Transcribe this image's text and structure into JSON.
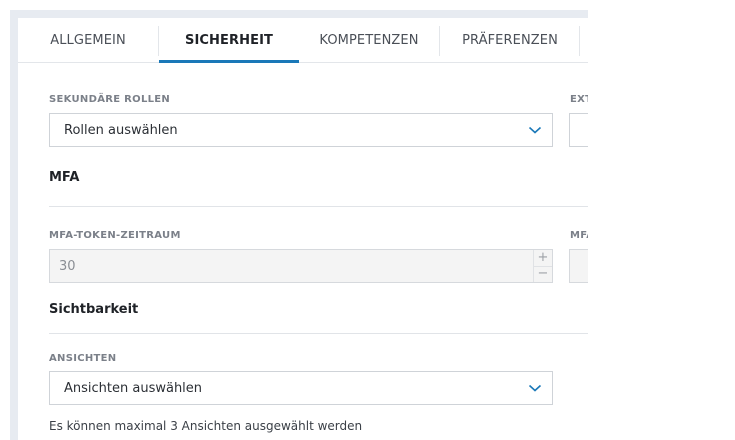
{
  "tabs": [
    {
      "label": "ALLGEMEIN",
      "active": false
    },
    {
      "label": "SICHERHEIT",
      "active": true
    },
    {
      "label": "KOMPETENZEN",
      "active": false
    },
    {
      "label": "PRÄFERENZEN",
      "active": false
    }
  ],
  "secondary_roles": {
    "label": "SEKUNDÄRE ROLLEN",
    "value": "Rollen auswählen"
  },
  "right_column": {
    "ext_label": "EXT",
    "mfa_label": "MFA"
  },
  "mfa": {
    "section_title": "MFA",
    "token_period_label": "MFA-TOKEN-ZEITRAUM",
    "token_period_value": "30",
    "stepper_up": "+",
    "stepper_down": "−"
  },
  "visibility": {
    "section_title": "Sichtbarkeit",
    "views_label": "ANSICHTEN",
    "views_value": "Ansichten auswählen",
    "help_text": "Es können maximal 3 Ansichten ausgewählt werden"
  },
  "colors": {
    "accent": "#1a78b8",
    "frame_background": "#e7ebf1",
    "border": "#cfd3d8",
    "disabled_background": "#f4f4f4"
  },
  "icons": {
    "select_chevron": "chevron-down-icon"
  }
}
